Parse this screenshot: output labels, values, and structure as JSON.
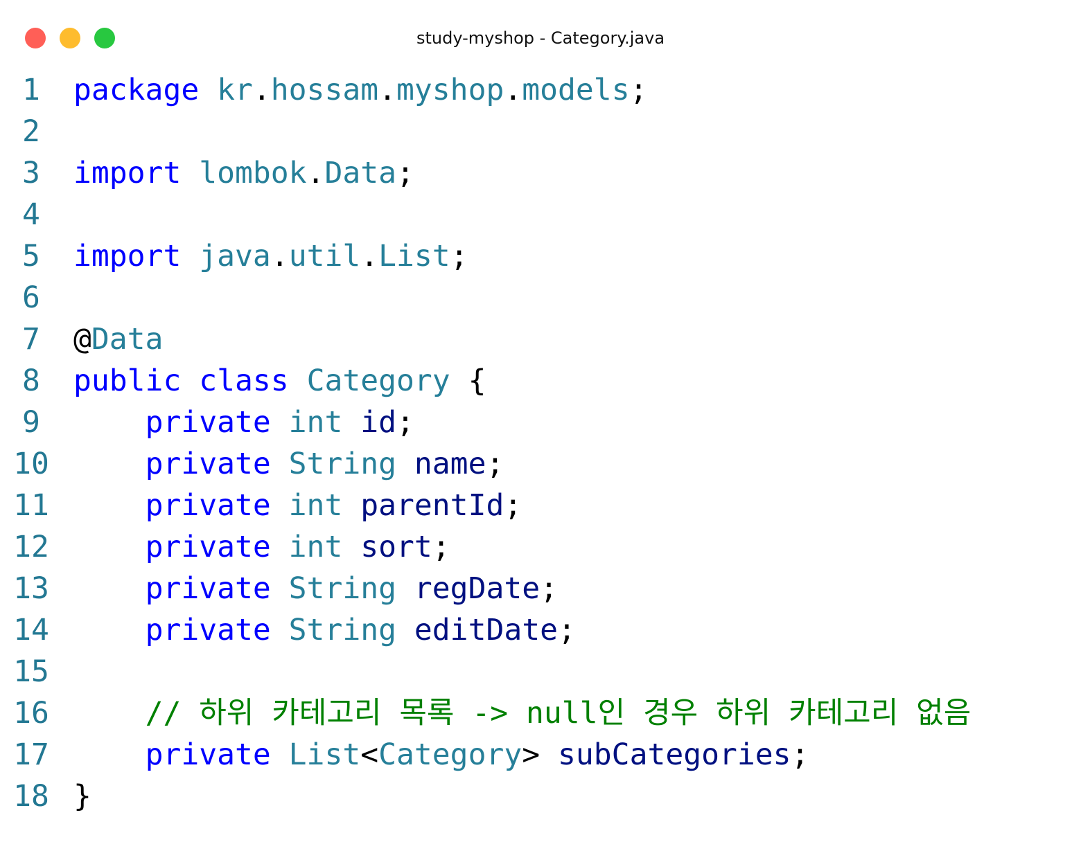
{
  "window": {
    "title": "study-myshop - Category.java",
    "traffic_lights": [
      "close",
      "minimize",
      "maximize"
    ],
    "colors": {
      "close": "#ff5f57",
      "minimize": "#febc2e",
      "maximize": "#28c840",
      "keyword": "#0000ff",
      "type": "#267f99",
      "variable": "#001080",
      "comment": "#008000",
      "line_number": "#237893"
    }
  },
  "editor": {
    "lines": [
      {
        "n": "1",
        "tokens": [
          [
            "kw",
            "package"
          ],
          [
            "pn",
            " "
          ],
          [
            "ty",
            "kr"
          ],
          [
            "pn",
            "."
          ],
          [
            "ty",
            "hossam"
          ],
          [
            "pn",
            "."
          ],
          [
            "ty",
            "myshop"
          ],
          [
            "pn",
            "."
          ],
          [
            "ty",
            "models"
          ],
          [
            "pn",
            ";"
          ]
        ]
      },
      {
        "n": "2",
        "tokens": []
      },
      {
        "n": "3",
        "tokens": [
          [
            "kw",
            "import"
          ],
          [
            "pn",
            " "
          ],
          [
            "ty",
            "lombok"
          ],
          [
            "pn",
            "."
          ],
          [
            "ty",
            "Data"
          ],
          [
            "pn",
            ";"
          ]
        ]
      },
      {
        "n": "4",
        "tokens": []
      },
      {
        "n": "5",
        "tokens": [
          [
            "kw",
            "import"
          ],
          [
            "pn",
            " "
          ],
          [
            "ty",
            "java"
          ],
          [
            "pn",
            "."
          ],
          [
            "ty",
            "util"
          ],
          [
            "pn",
            "."
          ],
          [
            "ty",
            "List"
          ],
          [
            "pn",
            ";"
          ]
        ]
      },
      {
        "n": "6",
        "tokens": []
      },
      {
        "n": "7",
        "tokens": [
          [
            "pn",
            "@"
          ],
          [
            "ty",
            "Data"
          ]
        ]
      },
      {
        "n": "8",
        "tokens": [
          [
            "kw",
            "public"
          ],
          [
            "pn",
            " "
          ],
          [
            "kw",
            "class"
          ],
          [
            "pn",
            " "
          ],
          [
            "ty",
            "Category"
          ],
          [
            "pn",
            " {"
          ]
        ]
      },
      {
        "n": "9",
        "tokens": [
          [
            "pn",
            "    "
          ],
          [
            "kw",
            "private"
          ],
          [
            "pn",
            " "
          ],
          [
            "ty",
            "int"
          ],
          [
            "pn",
            " "
          ],
          [
            "var",
            "id"
          ],
          [
            "pn",
            ";"
          ]
        ]
      },
      {
        "n": "10",
        "tokens": [
          [
            "pn",
            "    "
          ],
          [
            "kw",
            "private"
          ],
          [
            "pn",
            " "
          ],
          [
            "ty",
            "String"
          ],
          [
            "pn",
            " "
          ],
          [
            "var",
            "name"
          ],
          [
            "pn",
            ";"
          ]
        ]
      },
      {
        "n": "11",
        "tokens": [
          [
            "pn",
            "    "
          ],
          [
            "kw",
            "private"
          ],
          [
            "pn",
            " "
          ],
          [
            "ty",
            "int"
          ],
          [
            "pn",
            " "
          ],
          [
            "var",
            "parentId"
          ],
          [
            "pn",
            ";"
          ]
        ]
      },
      {
        "n": "12",
        "tokens": [
          [
            "pn",
            "    "
          ],
          [
            "kw",
            "private"
          ],
          [
            "pn",
            " "
          ],
          [
            "ty",
            "int"
          ],
          [
            "pn",
            " "
          ],
          [
            "var",
            "sort"
          ],
          [
            "pn",
            ";"
          ]
        ]
      },
      {
        "n": "13",
        "tokens": [
          [
            "pn",
            "    "
          ],
          [
            "kw",
            "private"
          ],
          [
            "pn",
            " "
          ],
          [
            "ty",
            "String"
          ],
          [
            "pn",
            " "
          ],
          [
            "var",
            "regDate"
          ],
          [
            "pn",
            ";"
          ]
        ]
      },
      {
        "n": "14",
        "tokens": [
          [
            "pn",
            "    "
          ],
          [
            "kw",
            "private"
          ],
          [
            "pn",
            " "
          ],
          [
            "ty",
            "String"
          ],
          [
            "pn",
            " "
          ],
          [
            "var",
            "editDate"
          ],
          [
            "pn",
            ";"
          ]
        ]
      },
      {
        "n": "15",
        "tokens": []
      },
      {
        "n": "16",
        "tokens": [
          [
            "pn",
            "    "
          ],
          [
            "cm",
            "// 하위 카테고리 목록 -> null인 경우 하위 카테고리 없음"
          ]
        ]
      },
      {
        "n": "17",
        "tokens": [
          [
            "pn",
            "    "
          ],
          [
            "kw",
            "private"
          ],
          [
            "pn",
            " "
          ],
          [
            "ty",
            "List"
          ],
          [
            "pn",
            "<"
          ],
          [
            "ty",
            "Category"
          ],
          [
            "pn",
            "> "
          ],
          [
            "var",
            "subCategories"
          ],
          [
            "pn",
            ";"
          ]
        ]
      },
      {
        "n": "18",
        "tokens": [
          [
            "pn",
            "}"
          ]
        ]
      }
    ]
  }
}
